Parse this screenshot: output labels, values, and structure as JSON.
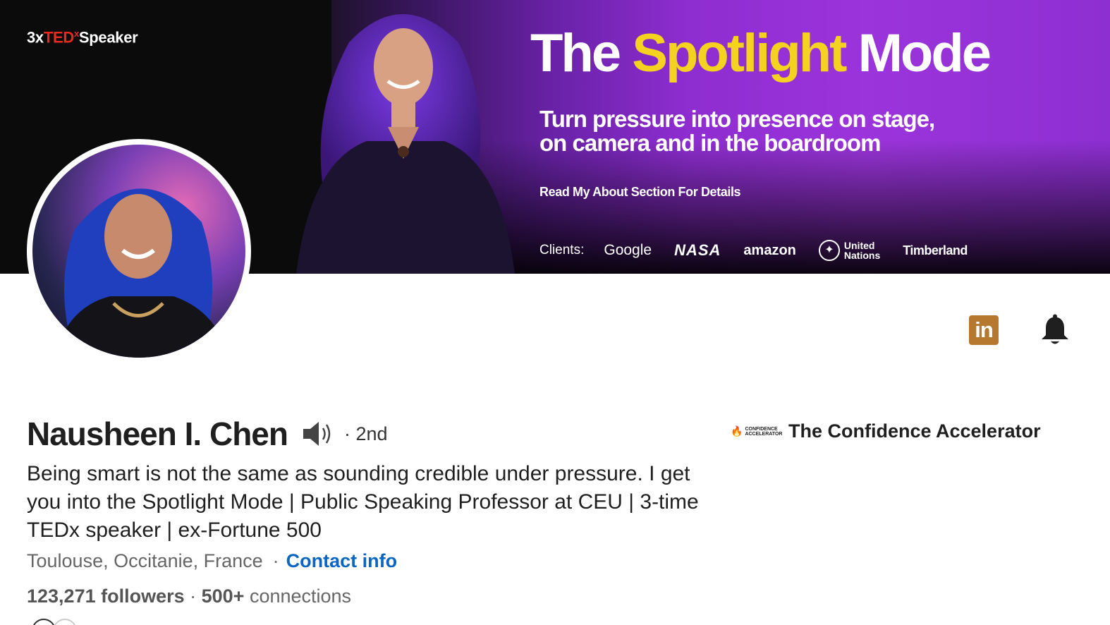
{
  "banner": {
    "badge_prefix": "3x",
    "badge_ted": "TED",
    "badge_x": "x",
    "badge_suffix": "Speaker",
    "title_part1": "The",
    "title_accent": "Spotlight",
    "title_part2": "Mode",
    "subtitle_line1": "Turn pressure into presence on stage,",
    "subtitle_line2": "on camera and in the boardroom",
    "read_more": "Read My About Section For Details",
    "clients_label": "Clients:",
    "clients": [
      "Google",
      "NASA",
      "amazon",
      "United",
      "Nations",
      "Timberland"
    ]
  },
  "actions": {
    "linkedin_icon": "linkedin-icon",
    "bell_icon": "bell-icon",
    "linkedin_text": "in"
  },
  "profile": {
    "name": "Nausheen I. Chen",
    "degree": "· 2nd",
    "headline": "Being smart is not the same as sounding credible under pressure. I get you into the Spotlight Mode | Public Speaking Professor at CEU | 3-time TEDx speaker | ex-Fortune 500",
    "location": "Toulouse, Occitanie, France",
    "location_separator": "·",
    "contact_info": "Contact info",
    "followers": "123,271 followers",
    "stats_separator": " · ",
    "connections_count": "500+",
    "connections_label": " connections"
  },
  "company": {
    "logo_text_1": "CONFIDENCE",
    "logo_text_2": "ACCELERATOR",
    "name": "The Confidence Accelerator"
  },
  "colors": {
    "accent_yellow": "#f4d21f",
    "link_blue": "#0a66c2",
    "linkedin_bronze": "#b5782e",
    "banner_purple": "#9b34db"
  }
}
